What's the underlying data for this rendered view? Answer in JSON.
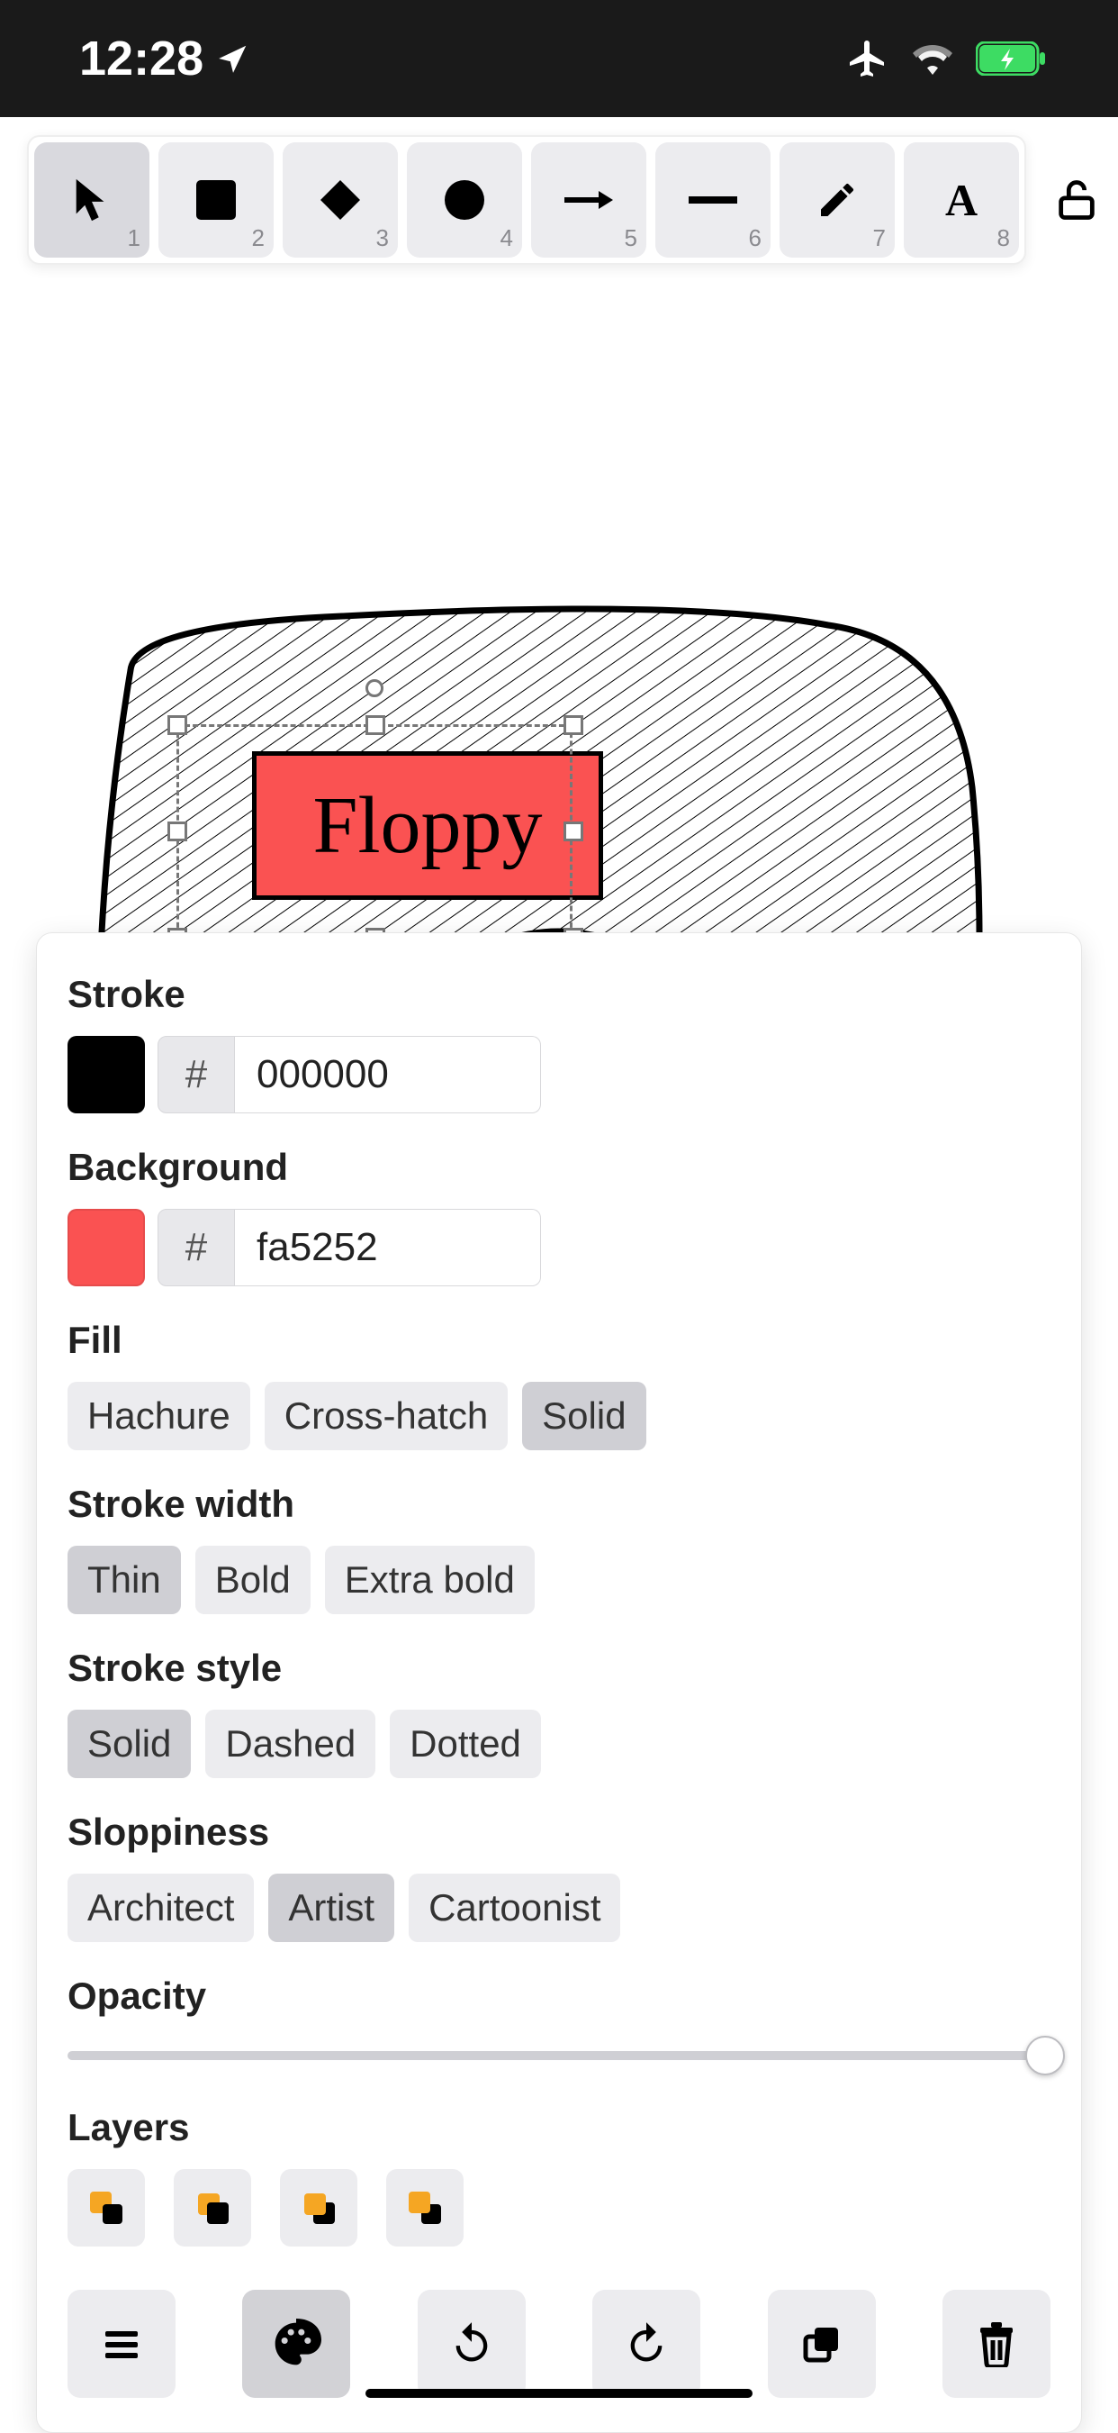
{
  "status": {
    "time": "12:28",
    "airplane_mode": true,
    "wifi": true,
    "battery_charging": true
  },
  "toolbar": {
    "tools": [
      {
        "name": "selection",
        "num": "1",
        "active": true
      },
      {
        "name": "rectangle",
        "num": "2",
        "active": false
      },
      {
        "name": "diamond",
        "num": "3",
        "active": false
      },
      {
        "name": "ellipse",
        "num": "4",
        "active": false
      },
      {
        "name": "arrow",
        "num": "5",
        "active": false
      },
      {
        "name": "line",
        "num": "6",
        "active": false
      },
      {
        "name": "draw",
        "num": "7",
        "active": false
      },
      {
        "name": "text",
        "num": "8",
        "active": false
      }
    ],
    "locked": false
  },
  "canvas": {
    "selected_label_text": "Floppy",
    "label_background": "#fa5252"
  },
  "panel": {
    "stroke": {
      "label": "Stroke",
      "hex": "000000",
      "swatch": "#000000"
    },
    "background": {
      "label": "Background",
      "hex": "fa5252",
      "swatch": "#fa5252"
    },
    "fill": {
      "label": "Fill",
      "options": [
        "Hachure",
        "Cross-hatch",
        "Solid"
      ],
      "active": "Solid"
    },
    "stroke_width": {
      "label": "Stroke width",
      "options": [
        "Thin",
        "Bold",
        "Extra bold"
      ],
      "active": "Thin"
    },
    "stroke_style": {
      "label": "Stroke style",
      "options": [
        "Solid",
        "Dashed",
        "Dotted"
      ],
      "active": "Solid"
    },
    "sloppiness": {
      "label": "Sloppiness",
      "options": [
        "Architect",
        "Artist",
        "Cartoonist"
      ],
      "active": "Artist"
    },
    "opacity": {
      "label": "Opacity",
      "value": 100
    },
    "layers": {
      "label": "Layers",
      "buttons": [
        "send-to-back",
        "send-backward",
        "bring-forward",
        "bring-to-front"
      ]
    },
    "bottom": {
      "buttons": [
        "menu",
        "palette",
        "undo",
        "redo",
        "duplicate",
        "delete"
      ],
      "active": "palette"
    }
  },
  "hash_symbol": "#"
}
